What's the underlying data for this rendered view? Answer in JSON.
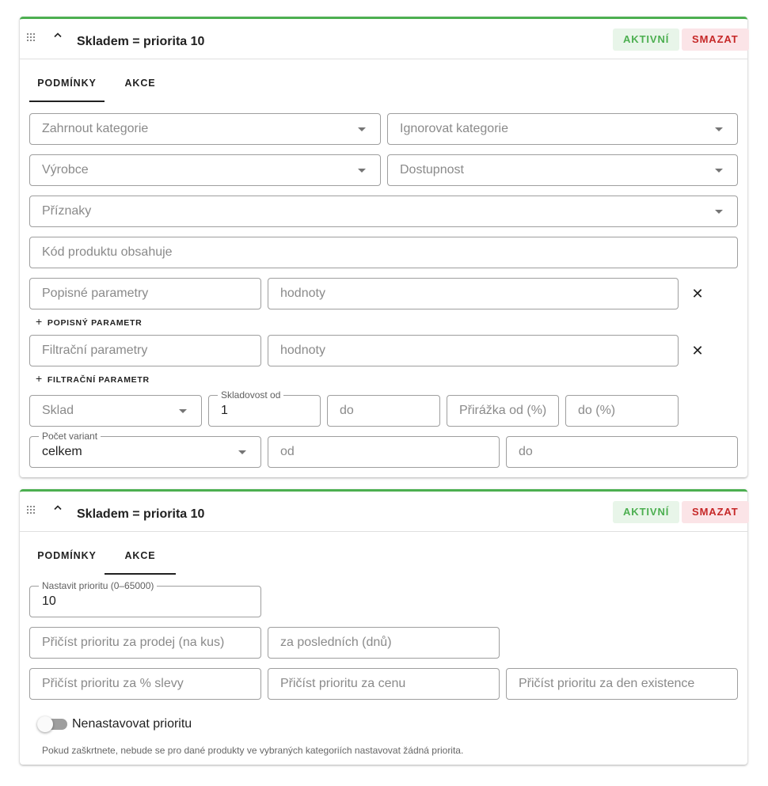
{
  "rules": [
    {
      "title": "Skladem = priorita 10",
      "active_label": "AKTIVNÍ",
      "delete_label": "SMAZAT",
      "tabs": [
        "PODMÍNKY",
        "AKCE"
      ],
      "conditions": {
        "include_categories": "Zahrnout kategorie",
        "ignore_categories": "Ignorovat kategorie",
        "manufacturer": "Výrobce",
        "availability": "Dostupnost",
        "flags": "Příznaky",
        "product_code": "Kód produktu obsahuje",
        "desc_param": "Popisné parametry",
        "desc_values": "hodnoty",
        "add_desc_param": "POPISNÝ PARAMETR",
        "filter_param": "Filtrační parametry",
        "filter_values": "hodnoty",
        "add_filter_param": "FILTRAČNÍ PARAMETR",
        "warehouse": "Sklad",
        "stock_from_label": "Skladovost od",
        "stock_from_value": "1",
        "stock_to": "do",
        "margin_from": "Přirážka od (%)",
        "margin_to": "do (%)",
        "variants_label": "Počet variant",
        "variants_value": "celkem",
        "variants_from": "od",
        "variants_to": "do"
      }
    },
    {
      "title": "Skladem = priorita 10",
      "active_label": "AKTIVNÍ",
      "delete_label": "SMAZAT",
      "tabs": [
        "PODMÍNKY",
        "AKCE"
      ],
      "actions": {
        "priority_label": "Nastavit prioritu (0–65000)",
        "priority_value": "10",
        "sale_priority": "Přičíst prioritu za prodej (na kus)",
        "last_days": "za posledních (dnů)",
        "discount_priority": "Přičíst prioritu za % slevy",
        "price_priority": "Přičíst prioritu za cenu",
        "existence_priority": "Přičíst prioritu za den existence",
        "no_priority_label": "Nenastavovat prioritu",
        "no_priority_hint": "Pokud zaškrtnete, nebude se pro dané produkty ve vybraných kategoriích nastavovat žádná priorita."
      }
    }
  ],
  "colors": {
    "accent": "#4caf50",
    "danger": "#c62828"
  },
  "icons": {
    "drag": "drag-handle-icon",
    "collapse": "chevron-up-icon",
    "remove": "close-icon",
    "add": "plus-icon"
  }
}
